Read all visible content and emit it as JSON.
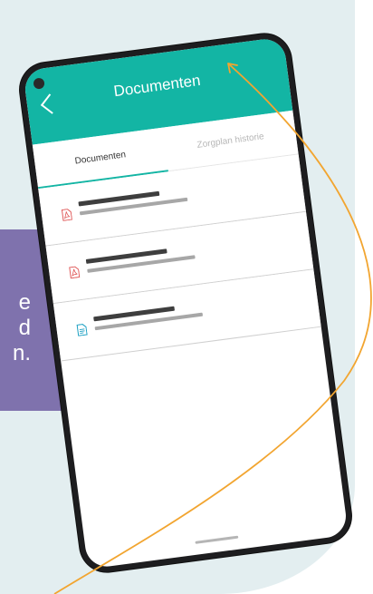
{
  "background": {
    "panel_color": "#e3eef0",
    "card_color": "#7f72ad",
    "card_text": [
      "e",
      "d",
      "n."
    ],
    "curve_color": "#f2a530"
  },
  "app": {
    "title": "Documenten",
    "accent_color": "#13b5a4",
    "back_icon": "chevron-left-icon",
    "tabs": [
      {
        "label": "Documenten",
        "active": true
      },
      {
        "label": "Zorgplan historie",
        "active": false
      }
    ],
    "documents": [
      {
        "icon": "pdf-file-icon",
        "icon_color": "#e05a5a"
      },
      {
        "icon": "pdf-file-icon",
        "icon_color": "#e05a5a"
      },
      {
        "icon": "text-file-icon",
        "icon_color": "#1a9fc2"
      }
    ]
  }
}
